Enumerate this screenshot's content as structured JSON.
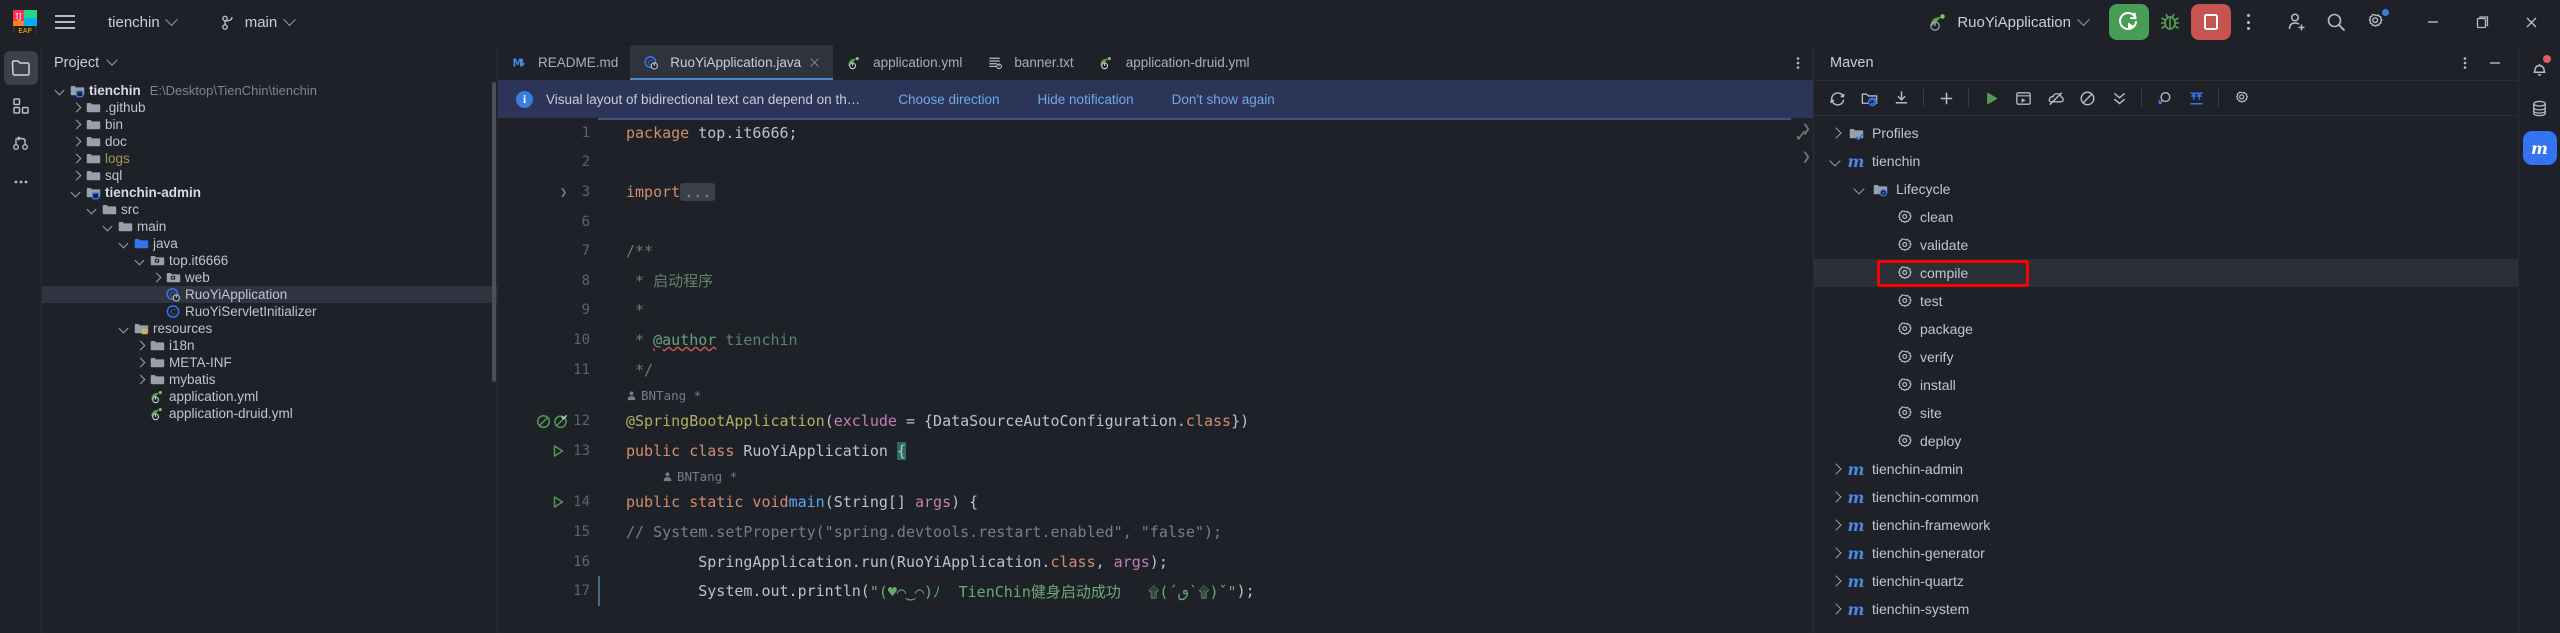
{
  "titlebar": {
    "menu_icon": "hamburger-icon",
    "project_name": "tienchin",
    "branch_name": "main",
    "branch_icon": "vcs-branch-icon",
    "run_config": "RuoYiApplication",
    "run_button": "run-icon",
    "debug_button": "debug-icon",
    "stop_button": "stop-icon",
    "more_button": "more-vertical-icon",
    "account_icon": "account-add-icon",
    "search_icon": "search-icon",
    "settings_icon": "gear-icon",
    "minimize": "minimize-icon",
    "maximize": "restore-icon",
    "close": "close-icon"
  },
  "activity_bar": {
    "items": [
      {
        "name": "project-tool-icon",
        "active": true
      },
      {
        "name": "structure-tool-icon",
        "active": false
      },
      {
        "name": "commit-vcs-icon",
        "active": false
      },
      {
        "name": "more-tools-icon",
        "active": false
      }
    ]
  },
  "project_panel": {
    "title": "Project",
    "tree": [
      {
        "depth": 0,
        "twist": "d",
        "icon": "module-folder-icon",
        "label": "tienchin",
        "bold": true,
        "sub": "E:\\Desktop\\TienChin\\tienchin"
      },
      {
        "depth": 1,
        "twist": "r",
        "icon": "folder-icon",
        "label": ".github"
      },
      {
        "depth": 1,
        "twist": "r",
        "icon": "folder-icon",
        "label": "bin"
      },
      {
        "depth": 1,
        "twist": "r",
        "icon": "folder-icon",
        "label": "doc"
      },
      {
        "depth": 1,
        "twist": "r",
        "icon": "folder-icon",
        "label": "logs",
        "color": "logs"
      },
      {
        "depth": 1,
        "twist": "r",
        "icon": "folder-icon",
        "label": "sql"
      },
      {
        "depth": 1,
        "twist": "d",
        "icon": "module-folder-icon",
        "label": "tienchin-admin",
        "bold": true
      },
      {
        "depth": 2,
        "twist": "d",
        "icon": "folder-icon",
        "label": "src"
      },
      {
        "depth": 3,
        "twist": "d",
        "icon": "folder-icon",
        "label": "main"
      },
      {
        "depth": 4,
        "twist": "d",
        "icon": "source-root-icon",
        "label": "java"
      },
      {
        "depth": 5,
        "twist": "d",
        "icon": "package-icon",
        "label": "top.it6666"
      },
      {
        "depth": 6,
        "twist": "r",
        "icon": "package-icon",
        "label": "web"
      },
      {
        "depth": 6,
        "twist": "",
        "icon": "java-class-run-icon",
        "label": "RuoYiApplication",
        "selected": true
      },
      {
        "depth": 6,
        "twist": "",
        "icon": "java-class-icon",
        "label": "RuoYiServletInitializer"
      },
      {
        "depth": 4,
        "twist": "d",
        "icon": "resources-root-icon",
        "label": "resources"
      },
      {
        "depth": 5,
        "twist": "r",
        "icon": "folder-icon",
        "label": "i18n"
      },
      {
        "depth": 5,
        "twist": "r",
        "icon": "folder-icon",
        "label": "META-INF"
      },
      {
        "depth": 5,
        "twist": "r",
        "icon": "folder-icon",
        "label": "mybatis"
      },
      {
        "depth": 5,
        "twist": "",
        "icon": "spring-yml-icon",
        "label": "application.yml"
      },
      {
        "depth": 5,
        "twist": "",
        "icon": "spring-yml-icon",
        "label": "application-druid.yml"
      }
    ]
  },
  "editor": {
    "tabs": [
      {
        "label": "README.md",
        "icon": "markdown-icon",
        "active": false,
        "closable": false
      },
      {
        "label": "RuoYiApplication.java",
        "icon": "java-class-run-icon",
        "active": true,
        "closable": true
      },
      {
        "label": "application.yml",
        "icon": "spring-yml-icon",
        "active": false,
        "closable": false
      },
      {
        "label": "banner.txt",
        "icon": "text-file-icon",
        "active": false,
        "closable": false
      },
      {
        "label": "application-druid.yml",
        "icon": "spring-yml-icon",
        "active": false,
        "closable": false
      }
    ],
    "tabs_more_icon": "more-vertical-icon",
    "notification": {
      "icon": "info-icon",
      "message": "Visual layout of bidirectional text can depend on th…",
      "actions": [
        "Choose direction",
        "Hide notification",
        "Don't show again"
      ]
    },
    "gutter_numbers": [
      "1",
      "2",
      "3",
      "6",
      "7",
      "8",
      "9",
      "10",
      "11",
      "12",
      "13",
      "14",
      "15",
      "16",
      "17"
    ],
    "inlay_hints": [
      "BNTang *",
      "BNTang *"
    ],
    "code_lines": [
      "package top.it6666;",
      "",
      "import ...",
      "",
      "/**",
      " * 启动程序",
      " *",
      " * @author tienchin",
      " */",
      "@SpringBootApplication(exclude = {DataSourceAutoConfiguration.class})",
      "public class RuoYiApplication {",
      "    public static void main(String[] args) {",
      "        // System.setProperty(\"spring.devtools.restart.enabled\", \"false\");",
      "        SpringApplication.run(RuoYiApplication.class, args);",
      "        System.out.println(\"(♥⌒‿⌒)ノ  TienChin健身启动成功   ݩ(´؂`ݩ)ˎ\");"
    ],
    "inspection_status": "ok-check-icon"
  },
  "maven": {
    "title": "Maven",
    "toolbar_icons": [
      "reload-icon",
      "reimport-project-icon",
      "download-sources-icon",
      "add-icon",
      "run-maven-build-icon",
      "execute-goal-icon",
      "toggle-skip-tests-icon",
      "toggle-offline-icon",
      "collapse-all-icon",
      "show-dependencies-icon",
      "expand-all-icon",
      "maven-settings-icon"
    ],
    "settings_icon": "gear-icon",
    "hide_icon": "minimize-icon",
    "tree": [
      {
        "depth": 0,
        "twist": "r",
        "icon": "profiles-folder-icon",
        "label": "Profiles"
      },
      {
        "depth": 0,
        "twist": "d",
        "icon": "maven-module-icon",
        "label": "tienchin"
      },
      {
        "depth": 1,
        "twist": "d",
        "icon": "lifecycle-folder-icon",
        "label": "Lifecycle"
      },
      {
        "depth": 2,
        "twist": "",
        "icon": "maven-goal-icon",
        "label": "clean"
      },
      {
        "depth": 2,
        "twist": "",
        "icon": "maven-goal-icon",
        "label": "validate"
      },
      {
        "depth": 2,
        "twist": "",
        "icon": "maven-goal-icon",
        "label": "compile",
        "selected": true,
        "highlighted": true
      },
      {
        "depth": 2,
        "twist": "",
        "icon": "maven-goal-icon",
        "label": "test"
      },
      {
        "depth": 2,
        "twist": "",
        "icon": "maven-goal-icon",
        "label": "package"
      },
      {
        "depth": 2,
        "twist": "",
        "icon": "maven-goal-icon",
        "label": "verify"
      },
      {
        "depth": 2,
        "twist": "",
        "icon": "maven-goal-icon",
        "label": "install"
      },
      {
        "depth": 2,
        "twist": "",
        "icon": "maven-goal-icon",
        "label": "site"
      },
      {
        "depth": 2,
        "twist": "",
        "icon": "maven-goal-icon",
        "label": "deploy"
      },
      {
        "depth": 0,
        "twist": "r",
        "icon": "maven-module-icon",
        "label": "tienchin-admin"
      },
      {
        "depth": 0,
        "twist": "r",
        "icon": "maven-module-icon",
        "label": "tienchin-common"
      },
      {
        "depth": 0,
        "twist": "r",
        "icon": "maven-module-icon",
        "label": "tienchin-framework"
      },
      {
        "depth": 0,
        "twist": "r",
        "icon": "maven-module-icon",
        "label": "tienchin-generator"
      },
      {
        "depth": 0,
        "twist": "r",
        "icon": "maven-module-icon",
        "label": "tienchin-quartz"
      },
      {
        "depth": 0,
        "twist": "r",
        "icon": "maven-module-icon",
        "label": "tienchin-system"
      }
    ]
  },
  "right_bar": {
    "items": [
      {
        "name": "notifications-bell-icon",
        "badge": true
      },
      {
        "name": "database-icon",
        "badge": false
      },
      {
        "name": "maven-tool-icon",
        "badge": false,
        "active": true
      }
    ]
  },
  "colors": {
    "background": "#1e2128",
    "accent_blue": "#3574f0",
    "run_green": "#499c54",
    "stop_red": "#c75450",
    "highlight_red": "#fe0000",
    "notification_bg": "#2c3557",
    "selection": "#2f3440"
  }
}
